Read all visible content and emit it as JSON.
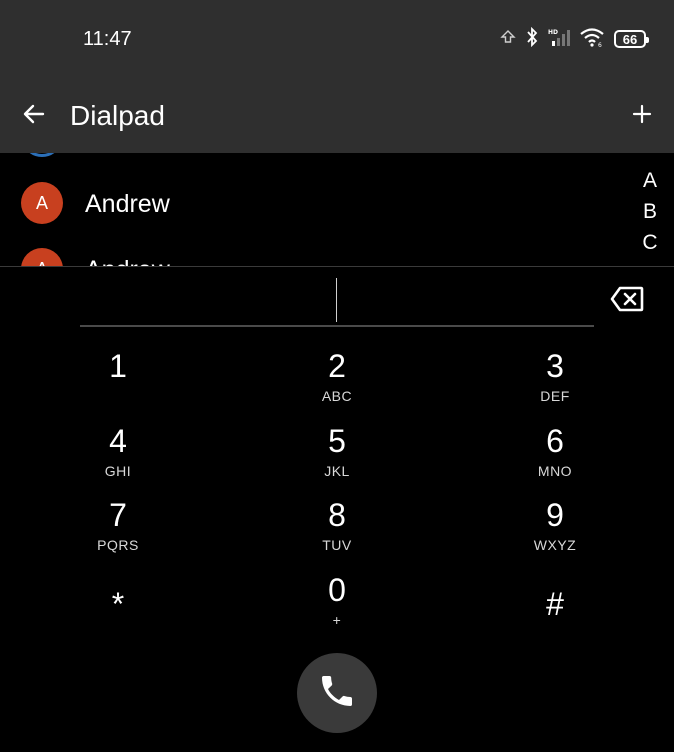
{
  "status_bar": {
    "time": "11:47",
    "battery": "66"
  },
  "app_bar": {
    "title": "Dialpad"
  },
  "contacts": [
    {
      "initial": "A",
      "name": "Andrew"
    },
    {
      "initial": "A",
      "name": "Andrew"
    }
  ],
  "alpha_index": [
    "A",
    "B",
    "C"
  ],
  "dialpad": {
    "input_value": "",
    "keys": [
      {
        "digit": "1",
        "letters": ""
      },
      {
        "digit": "2",
        "letters": "ABC"
      },
      {
        "digit": "3",
        "letters": "DEF"
      },
      {
        "digit": "4",
        "letters": "GHI"
      },
      {
        "digit": "5",
        "letters": "JKL"
      },
      {
        "digit": "6",
        "letters": "MNO"
      },
      {
        "digit": "7",
        "letters": "PQRS"
      },
      {
        "digit": "8",
        "letters": "TUV"
      },
      {
        "digit": "9",
        "letters": "WXYZ"
      },
      {
        "digit": "*",
        "letters": ""
      },
      {
        "digit": "0",
        "letters": "+"
      },
      {
        "digit": "#",
        "letters": ""
      }
    ]
  },
  "colors": {
    "app_bar_bg": "#2f2f2f",
    "background": "#000000",
    "avatar": "#c8401f",
    "call_button": "#3a3a3a"
  },
  "icons": {
    "back": "arrow-left-icon",
    "add": "plus-icon",
    "backspace": "backspace-icon",
    "call": "phone-icon"
  }
}
